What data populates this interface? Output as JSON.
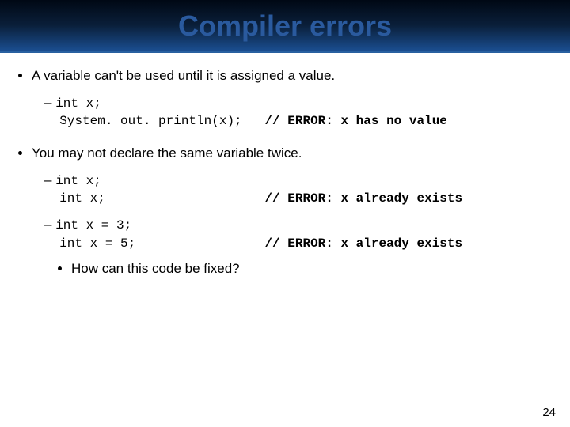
{
  "title": "Compiler errors",
  "bullets": {
    "b1": "A variable can't be used until it is assigned a value.",
    "b2": "You may not declare the same variable twice.",
    "sub": "How can this code be fixed?"
  },
  "code": {
    "c1a": "int x;",
    "c1b": "System. out. println(x);   ",
    "c1c": "// ERROR: x has no value",
    "c2a": "int x;",
    "c2b": "int x;                     ",
    "c2c": "// ERROR: x already exists",
    "c3a": "int x = 3;",
    "c3b": "int x = 5;                 ",
    "c3c": "// ERROR: x already exists"
  },
  "page": "24"
}
